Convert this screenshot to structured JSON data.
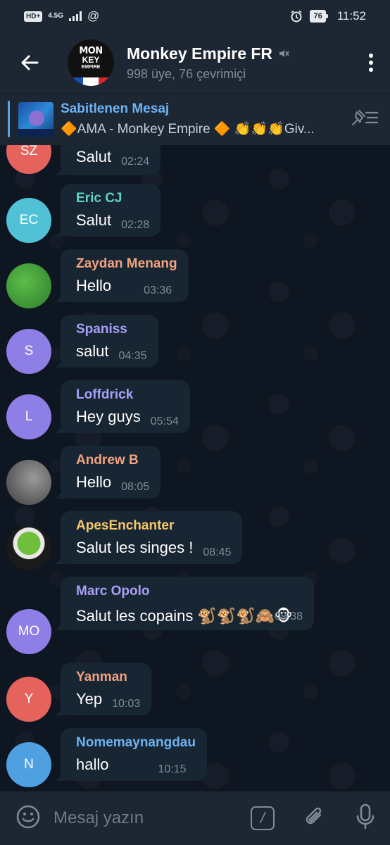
{
  "status_bar": {
    "hd": "HD+",
    "network": "4.5G",
    "at_symbol": "@",
    "battery": "76",
    "time": "11:52"
  },
  "header": {
    "title": "Monkey Empire FR",
    "subtitle": "998 üye, 76 çevrimiçi",
    "avatar_logo_top": "MON",
    "avatar_logo_mid": "KEY",
    "avatar_logo_bottom": "EMPIRE"
  },
  "pinned": {
    "label": "Sabitlenen Mesaj",
    "preview": "🔶AMA - Monkey Empire 🔶  👏👏👏Giv..."
  },
  "messages": [
    {
      "initials": "SZ",
      "avatar_color": "#e5635c",
      "sender": "",
      "sender_color": "",
      "text": "Salut",
      "time": "02:24"
    },
    {
      "initials": "EC",
      "avatar_color": "#51c2d6",
      "sender": "Eric CJ",
      "sender_color": "#5fd5c4",
      "text": "Salut",
      "time": "02:28"
    },
    {
      "initials": "",
      "avatar_color": "#3f9a3a",
      "sender": "Zaydan Menang",
      "sender_color": "#f3a27d",
      "text": "Hello",
      "time": "03:36"
    },
    {
      "initials": "S",
      "avatar_color": "#8e7fe6",
      "sender": "Spaniss",
      "sender_color": "#a7a0f6",
      "text": "salut",
      "time": "04:35"
    },
    {
      "initials": "L",
      "avatar_color": "#8e7fe6",
      "sender": "Loffdrick",
      "sender_color": "#a7a0f6",
      "text": "Hey guys",
      "time": "05:54"
    },
    {
      "initials": "",
      "avatar_color": "#6d6d6d",
      "sender": "Andrew B",
      "sender_color": "#f3a27d",
      "text": "Hello",
      "time": "08:05"
    },
    {
      "initials": "",
      "avatar_color": "#2a2a2a",
      "sender": "ApesEnchanter",
      "sender_color": "#f6c86a",
      "text": "Salut les singes !",
      "time": "08:45"
    },
    {
      "initials": "MO",
      "avatar_color": "#8e7fe6",
      "sender": "Marc Opolo",
      "sender_color": "#a7a0f6",
      "text": "Salut les copains 🐒🐒🐒🙈🐵",
      "time": "09:38"
    },
    {
      "initials": "Y",
      "avatar_color": "#e5635c",
      "sender": "Yanman",
      "sender_color": "#f3a27d",
      "text": "Yep",
      "time": "10:03"
    },
    {
      "initials": "N",
      "avatar_color": "#4fa0e0",
      "sender": "Nomemaynangdau",
      "sender_color": "#6db3f2",
      "text": "hallo",
      "time": "10:15"
    }
  ],
  "composer": {
    "placeholder": "Mesaj yazın",
    "command_glyph": "/"
  },
  "icons": [
    "back-arrow-icon",
    "mute-icon",
    "more-vert-icon",
    "pin-list-icon",
    "emoji-icon",
    "bot-command-icon",
    "attach-icon",
    "mic-icon"
  ]
}
